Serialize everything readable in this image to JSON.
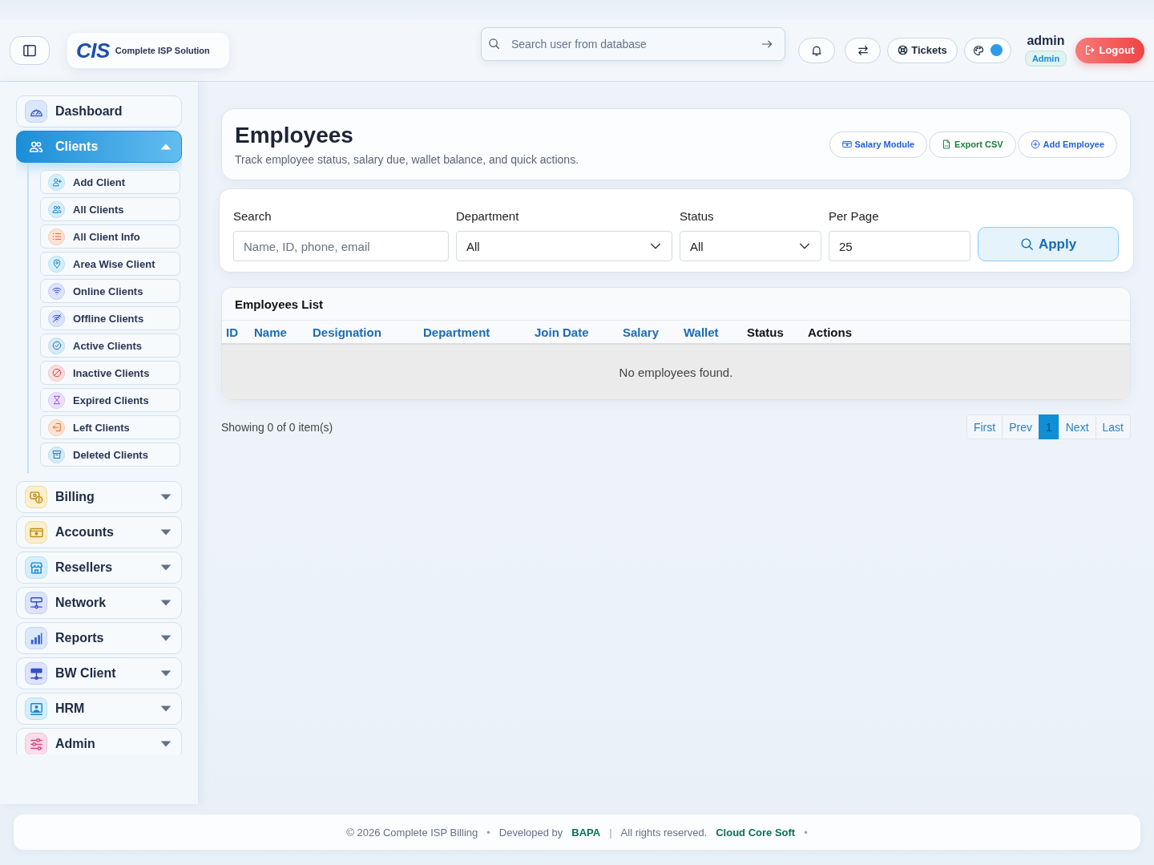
{
  "topbar": {
    "logo": {
      "mark": "CIS",
      "tagline": "Complete **ISP** Solution"
    },
    "search": {
      "placeholder": "Search user from database"
    },
    "tickets_button": "Tickets",
    "theme": {
      "color": "#2f9be6"
    },
    "user": {
      "name": "admin",
      "role": "Admin"
    },
    "logout_button": "Logout"
  },
  "sidebar": {
    "items": [
      {
        "label": "Dashboard",
        "kind": "link",
        "selected": false
      },
      {
        "label": "Clients",
        "kind": "group",
        "selected": true,
        "expanded": true,
        "children": [
          {
            "label": "Add Client",
            "selected": false
          },
          {
            "label": "All Clients",
            "selected": false
          },
          {
            "label": "All Client Info",
            "selected": false
          },
          {
            "label": "Area Wise Client",
            "selected": false
          },
          {
            "label": "Online Clients",
            "selected": false
          },
          {
            "label": "Offline Clients",
            "selected": false
          },
          {
            "label": "Active Clients",
            "selected": false
          },
          {
            "label": "Inactive Clients",
            "selected": false
          },
          {
            "label": "Expired Clients",
            "selected": false
          },
          {
            "label": "Left Clients",
            "selected": false
          },
          {
            "label": "Deleted Clients",
            "selected": false
          }
        ]
      },
      {
        "label": "Billing",
        "kind": "group",
        "selected": false,
        "expanded": false
      },
      {
        "label": "Accounts",
        "kind": "group",
        "selected": false,
        "expanded": false
      },
      {
        "label": "Resellers",
        "kind": "group",
        "selected": false,
        "expanded": false
      },
      {
        "label": "Network",
        "kind": "group",
        "selected": false,
        "expanded": false
      },
      {
        "label": "Reports",
        "kind": "group",
        "selected": false,
        "expanded": false
      },
      {
        "label": "BW Client",
        "kind": "group",
        "selected": false,
        "expanded": false
      },
      {
        "label": "HRM",
        "kind": "group",
        "selected": false,
        "expanded": false
      },
      {
        "label": "Admin",
        "kind": "group",
        "selected": false,
        "expanded": false
      }
    ]
  },
  "page": {
    "title": "Employees",
    "subtitle": "Track employee status, salary due, wallet balance, and quick actions.",
    "actions": [
      {
        "kind": "salary",
        "label": "Salary Module"
      },
      {
        "kind": "export",
        "label": "Export CSV"
      },
      {
        "kind": "add",
        "label": "Add Employee"
      }
    ]
  },
  "filters": {
    "fields": [
      {
        "kind": "text",
        "label": "Search",
        "placeholder": "Name, ID, phone, email"
      },
      {
        "kind": "select",
        "label": "Department",
        "value": "All"
      },
      {
        "kind": "select",
        "label": "Status",
        "value": "All"
      },
      {
        "kind": "text",
        "label": "Per Page",
        "value": "25"
      }
    ],
    "apply_button": "Apply"
  },
  "table": {
    "title": "Employees List",
    "columns": [
      {
        "label": "ID",
        "sortable": true
      },
      {
        "label": "Name",
        "sortable": true
      },
      {
        "label": "Designation",
        "sortable": true
      },
      {
        "label": "Department",
        "sortable": true
      },
      {
        "label": "Join Date",
        "sortable": true
      },
      {
        "label": "Salary",
        "sortable": true
      },
      {
        "label": "Wallet",
        "sortable": true
      },
      {
        "label": "Status",
        "sortable": false
      },
      {
        "label": "Actions",
        "sortable": false
      }
    ],
    "empty_message": "No employees found."
  },
  "pagination": {
    "summary": "Showing 0 of 0 item(s)",
    "pages": [
      {
        "label": "First",
        "selected": false
      },
      {
        "label": "Prev",
        "selected": false
      },
      {
        "label": "1",
        "selected": true
      },
      {
        "label": "Next",
        "selected": false
      },
      {
        "label": "Last",
        "selected": false
      }
    ]
  },
  "footer": {
    "items": [
      {
        "kind": "text",
        "text": "© 2026 Complete ISP Billing"
      },
      {
        "kind": "separator",
        "text": "•"
      },
      {
        "kind": "text",
        "text": "Developed by"
      },
      {
        "kind": "link",
        "text": "BAPA"
      },
      {
        "kind": "separator",
        "text": "|"
      },
      {
        "kind": "text",
        "text": "All rights reserved."
      },
      {
        "kind": "link",
        "text": "Cloud Core Soft"
      },
      {
        "kind": "separator",
        "text": "•"
      }
    ]
  }
}
